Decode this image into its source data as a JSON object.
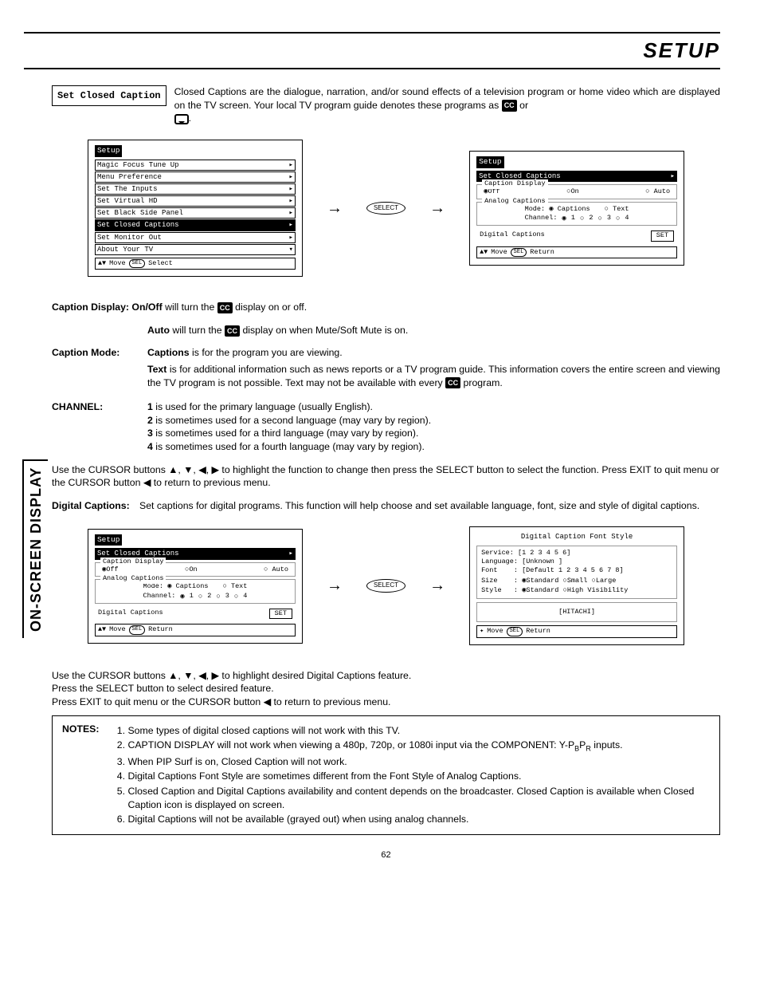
{
  "page": {
    "title": "SETUP",
    "sidebar": "ON-SCREEN DISPLAY",
    "number": "62"
  },
  "labelBox": "Set Closed Caption",
  "intro": {
    "line1": "Closed Captions are the dialogue, narration, and/or sound effects of a television program or home video which are displayed on the TV screen.  Your local TV program guide denotes these programs as ",
    "cc": "CC",
    "or": " or ",
    "period": "."
  },
  "osd1": {
    "title": "Setup",
    "items": [
      "Magic Focus Tune Up",
      "Menu Preference",
      "Set The Inputs",
      "Set Virtual HD",
      "Set Black Side Panel",
      "Set Closed Captions",
      "Set Monitor Out",
      "About Your TV"
    ],
    "highlighted": "Set Closed Captions",
    "footer_move": "Move",
    "footer_select": "Select"
  },
  "selectBtn": "SELECT",
  "osd2": {
    "title": "Setup",
    "sub": "Set Closed Captions",
    "capDisplay": "Caption Display",
    "off": "Off",
    "on": "On",
    "auto": "Auto",
    "analogLabel": "Analog Captions",
    "mode": "Mode:",
    "captions": "Captions",
    "text": "Text",
    "channel": "Channel:",
    "c1": "1",
    "c2": "2",
    "c3": "3",
    "c4": "4",
    "digital": "Digital Captions",
    "set": "SET",
    "footer_move": "Move",
    "footer_return": "Return"
  },
  "captionDisplay": {
    "label": "Caption Display: On/Off",
    "body": " will turn the ",
    "body2": " display on or off."
  },
  "autoLine": {
    "label": "Auto",
    "body": " will turn the ",
    "body2": " display on when Mute/Soft Mute is on."
  },
  "captionMode": {
    "label": "Caption Mode:",
    "captionsLabel": "Captions",
    "captionsBody": " is for the program you are viewing.",
    "textLabel": "Text",
    "textBody": " is for additional information such as news reports or a TV program guide.  This information covers the entire screen and viewing the TV program is not possible.  Text may not be available with every ",
    "textBody2": " program."
  },
  "channelSection": {
    "label": "CHANNEL:",
    "r1b": "1",
    "r1": " is used for the primary language (usually English).",
    "r2b": "2",
    "r2": " is sometimes used for a second language (may vary by region).",
    "r3b": "3",
    "r3": " is sometimes used for a third language (may vary by region).",
    "r4b": "4",
    "r4": " is sometimes used for a fourth language (may vary by region)."
  },
  "cursor1": "Use the CURSOR buttons ▲, ▼, ◀, ▶ to highlight the function to change then press the SELECT button to select the function. Press EXIT to quit menu or the CURSOR button ◀ to return to previous menu.",
  "digitalP": {
    "label": "Digital Captions:",
    "body": "Set captions for digital programs.  This function will help choose and set  available language, font, size and style of digital captions."
  },
  "osd3null": "",
  "osd4": {
    "title": "Digital Caption Font Style",
    "service": "Service:",
    "serviceVal": "[1 2 3 4 5 6]",
    "language": "Language:",
    "languageVal": "[Unknown    ]",
    "font": "Font",
    "fontVal": ": [Default 1 2 3 4 5 6 7 8]",
    "size": "Size",
    "sizeVal": ": ",
    "std": "Standard",
    "small": "Small",
    "large": "Large",
    "style": "Style",
    "styleVal": ": ",
    "hv": "High Visibility",
    "preview": "[HITACHI]",
    "footer_move": "Move",
    "footer_return": "Return"
  },
  "cursor2a": "Use the CURSOR buttons ▲, ▼, ◀, ▶ to highlight desired Digital Captions feature.",
  "cursor2b": "Press the SELECT button to select desired feature.",
  "cursor2c": "Press EXIT to quit menu or the CURSOR button ◀ to return to previous menu.",
  "notes": {
    "label": "NOTES:",
    "n1": "Some types of digital closed captions will not work with this TV.",
    "n2a": "CAPTION DISPLAY will not work when viewing a 480p, 720p, or 1080i input via the COMPONENT: Y-P",
    "n2b": "B",
    "n2c": "P",
    "n2d": "R",
    "n2e": " inputs.",
    "n3": "When PIP Surf is on, Closed Caption will not work.",
    "n4": "Digital Captions Font Style are sometimes different from the Font Style of Analog Captions.",
    "n5": "Closed Caption and Digital Captions availability and content depends on the broadcaster.  Closed Caption is available when Closed Caption icon is displayed on screen.",
    "n6": "Digital Captions will not be available (grayed out) when using analog channels."
  }
}
